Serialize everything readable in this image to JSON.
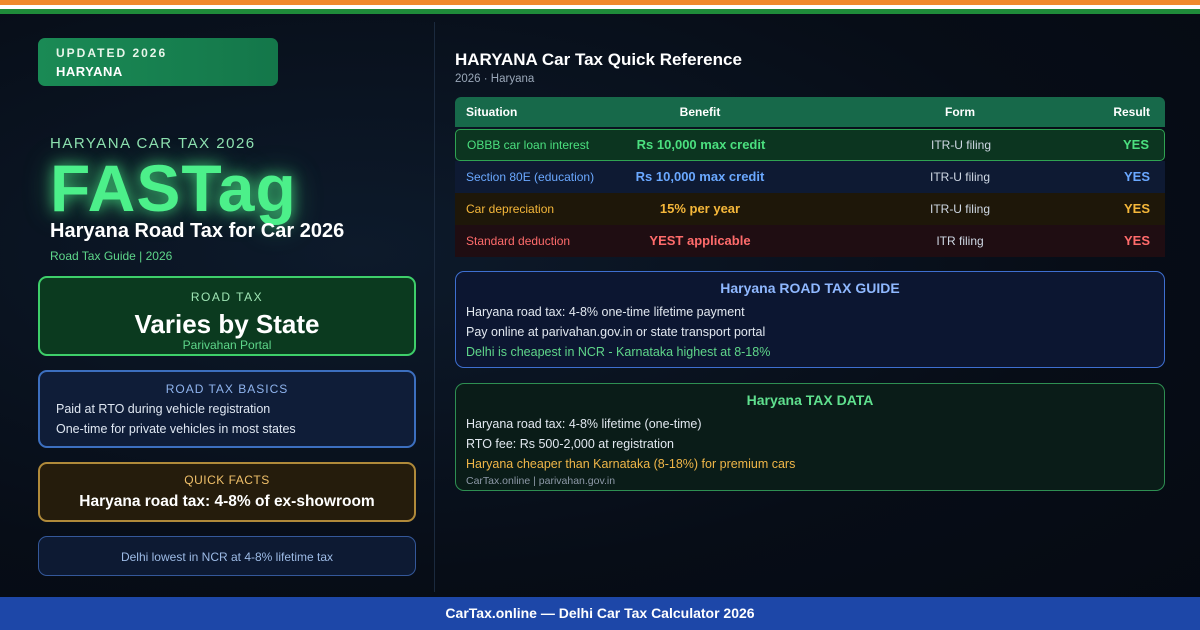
{
  "flag_colors": [
    "#f08a2c",
    "#ffffff",
    "#1f8b3a"
  ],
  "badge": {
    "line1": "UPDATED 2026",
    "line2": "HARYANA"
  },
  "hero": {
    "kicker": "HARYANA CAR TAX 2026",
    "headline": "FASTag",
    "title": "Haryana Road Tax for Car 2026",
    "subtitle": "Road Tax Guide | 2026"
  },
  "road_tax_card": {
    "label": "ROAD TAX",
    "value": "Varies by State",
    "note": "Parivahan Portal"
  },
  "basics_card": {
    "label": "ROAD TAX BASICS",
    "lines": [
      "Paid at RTO during vehicle registration",
      "One-time for private vehicles in most states"
    ]
  },
  "quick_facts_card": {
    "label": "QUICK FACTS",
    "value": "Haryana road tax: 4-8% of ex-showroom"
  },
  "note_card": {
    "text": "Delhi lowest in NCR at 4-8% lifetime tax"
  },
  "reference": {
    "title": "HARYANA Car Tax Quick Reference",
    "subtitle": "2026 · Haryana",
    "headers": [
      "Situation",
      "Benefit",
      "Form",
      "Result"
    ],
    "rows": [
      {
        "situation": "OBBB car loan interest",
        "benefit": "Rs 10,000 max credit",
        "form": "ITR-U filing",
        "result": "YES",
        "color": "#4be07f"
      },
      {
        "situation": "Section 80E (education)",
        "benefit": "Rs 10,000 max credit",
        "form": "ITR-U filing",
        "result": "YES",
        "color": "#6aa8ff"
      },
      {
        "situation": "Car depreciation",
        "benefit": "15% per year",
        "form": "ITR-U filing",
        "result": "YES",
        "color": "#f5b73a"
      },
      {
        "situation": "Standard deduction",
        "benefit": "YEST applicable",
        "form": "ITR filing",
        "result": "YES",
        "color": "#ff6b6b"
      }
    ]
  },
  "guide_panel": {
    "title": "Haryana ROAD TAX GUIDE",
    "lines": [
      "Haryana road tax: 4-8% one-time lifetime payment",
      "Pay online at parivahan.gov.in or state transport portal",
      "Delhi is cheapest in NCR - Karnataka highest at 8-18%"
    ]
  },
  "data_panel": {
    "title": "Haryana TAX DATA",
    "lines": [
      "Haryana road tax: 4-8% lifetime (one-time)",
      "RTO fee: Rs 500-2,000 at registration",
      "Haryana cheaper than Karnataka (8-18%) for premium cars"
    ],
    "source": "CarTax.online | parivahan.gov.in"
  },
  "footer": {
    "text": "CarTax.online — Delhi Car Tax Calculator 2026"
  }
}
